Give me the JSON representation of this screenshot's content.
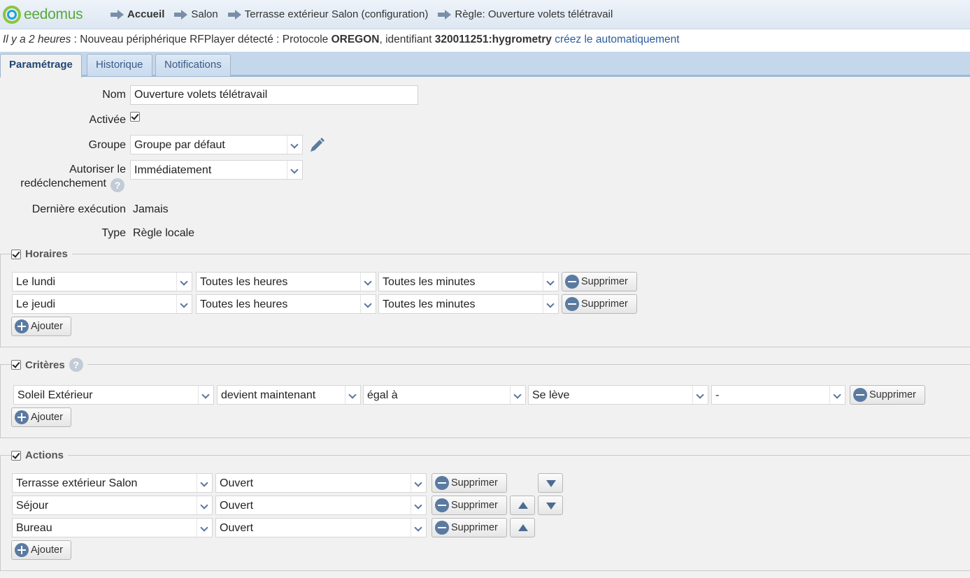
{
  "header": {
    "logo": "eedomus",
    "breadcrumb": [
      "Accueil",
      "Salon",
      "Terrasse extérieur Salon (configuration)",
      "Règle: Ouverture volets télétravail"
    ]
  },
  "notice": {
    "ago": "Il y a 2 heures",
    "text1": ": Nouveau périphérique RFPlayer détecté : Protocole ",
    "protocol": "OREGON",
    "text2": ", identifiant ",
    "identifier": "320011251:hygrometry",
    "link": "créez le automatiquement"
  },
  "tabs": [
    "Paramétrage",
    "Historique",
    "Notifications"
  ],
  "form": {
    "nom_label": "Nom",
    "nom_value": "Ouverture volets télétravail",
    "activee_label": "Activée",
    "groupe_label": "Groupe",
    "groupe_value": "Groupe par défaut",
    "autoriser_label1": "Autoriser le",
    "autoriser_label2": "redéclenchement",
    "autoriser_value": "Immédiatement",
    "derniere_label": "Dernière exécution",
    "derniere_value": "Jamais",
    "type_label": "Type",
    "type_value": "Règle locale"
  },
  "horaires": {
    "legend": "Horaires",
    "rows": [
      {
        "day": "Le lundi",
        "hours": "Toutes les heures",
        "minutes": "Toutes les minutes"
      },
      {
        "day": "Le jeudi",
        "hours": "Toutes les heures",
        "minutes": "Toutes les minutes"
      }
    ]
  },
  "criteres": {
    "legend": "Critères",
    "rows": [
      {
        "device": "Soleil Extérieur",
        "when": "devient maintenant",
        "op": "égal à",
        "value": "Se lève",
        "extra": "-"
      }
    ]
  },
  "actions": {
    "legend": "Actions",
    "rows": [
      {
        "device": "Terrasse extérieur Salon",
        "value": "Ouvert"
      },
      {
        "device": "Séjour",
        "value": "Ouvert"
      },
      {
        "device": "Bureau",
        "value": "Ouvert"
      }
    ]
  },
  "buttons": {
    "delete": "Supprimer",
    "add": "Ajouter"
  },
  "icons": {
    "help": "?"
  }
}
